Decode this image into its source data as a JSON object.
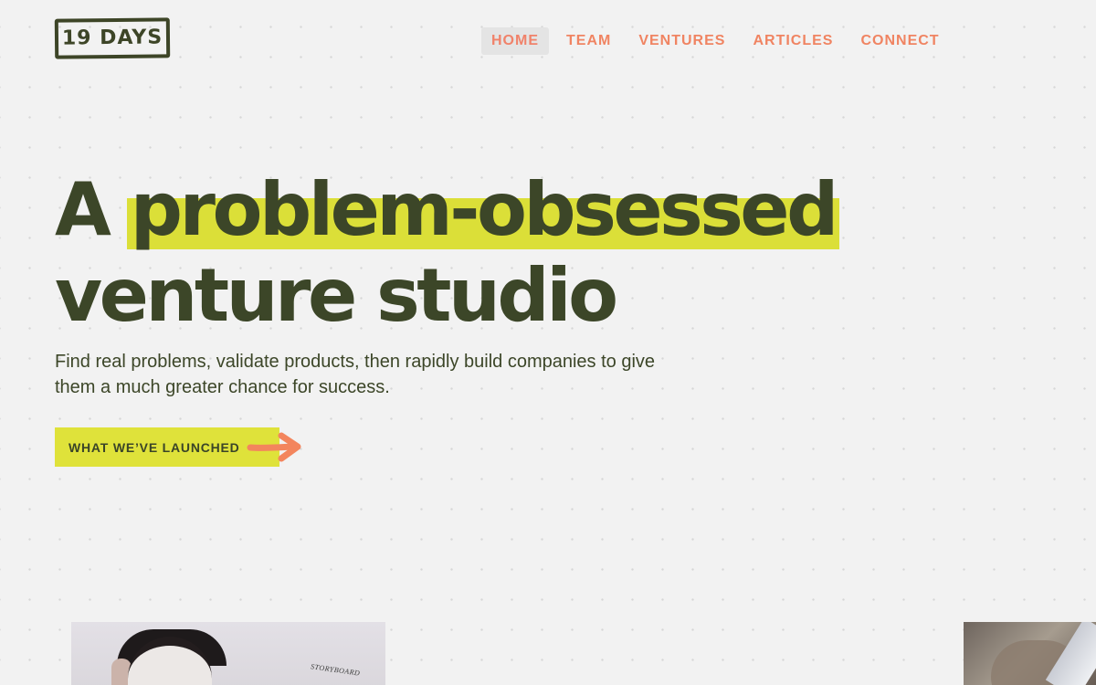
{
  "brand": {
    "logo_text": "19 DAYS"
  },
  "nav": {
    "items": [
      {
        "label": "HOME",
        "active": true
      },
      {
        "label": "TEAM",
        "active": false
      },
      {
        "label": "VENTURES",
        "active": false
      },
      {
        "label": "ARTICLES",
        "active": false
      },
      {
        "label": "CONNECT",
        "active": false
      }
    ]
  },
  "hero": {
    "line1_prefix": "A",
    "line1_highlight": "problem-obsessed",
    "line2": "venture studio",
    "subtitle": "Find real problems, validate products, then rapidly build companies to give them a much greater chance for success."
  },
  "cta": {
    "label": "WHAT WE’VE LAUNCHED",
    "icon": "arrow-right-icon"
  },
  "photos": {
    "left_board_text": "STORYBOARD"
  },
  "colors": {
    "background": "#f2f2f2",
    "text_dark": "#3c4628",
    "accent_yellow": "#dbdf38",
    "accent_coral": "#f08462",
    "nav_active_bg": "#e4e4e4"
  }
}
